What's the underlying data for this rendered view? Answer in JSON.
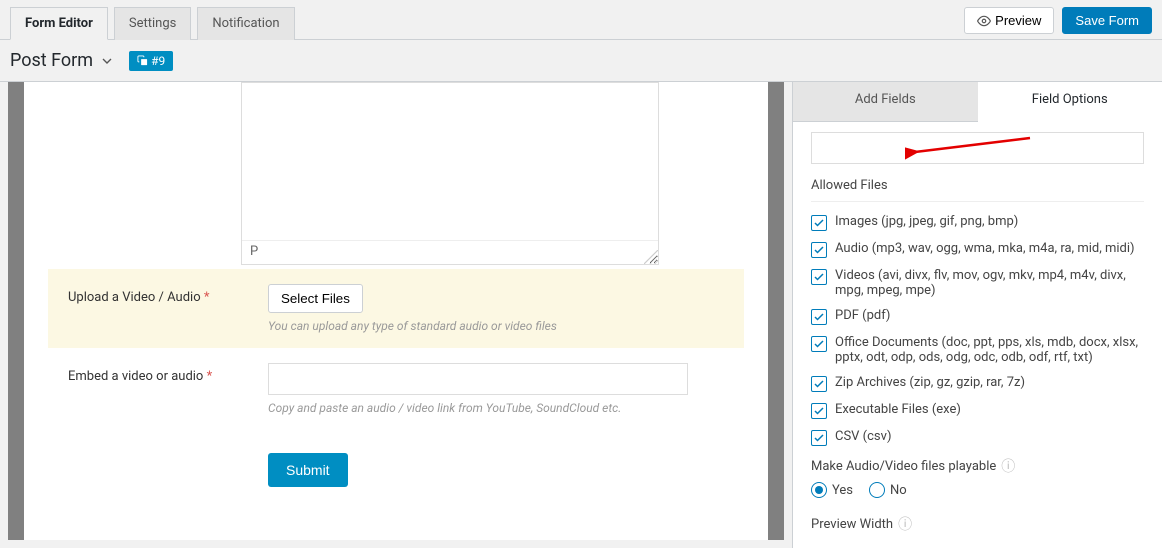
{
  "tabs": {
    "form_editor": "Form Editor",
    "settings": "Settings",
    "notification": "Notification"
  },
  "actions": {
    "preview": "Preview",
    "save": "Save Form"
  },
  "form": {
    "name": "Post Form",
    "count": "#9"
  },
  "editor": {
    "status": "P"
  },
  "upload_field": {
    "label": "Upload a Video / Audio",
    "button": "Select Files",
    "help": "You can upload any type of standard audio or video files"
  },
  "embed_field": {
    "label": "Embed a video or audio",
    "help": "Copy and paste an audio / video link from YouTube, SoundCloud etc."
  },
  "submit": "Submit",
  "panel_tabs": {
    "add": "Add Fields",
    "options": "Field Options"
  },
  "options": {
    "section": "Allowed Files",
    "types": [
      "Images (jpg, jpeg, gif, png, bmp)",
      "Audio (mp3, wav, ogg, wma, mka, m4a, ra, mid, midi)",
      "Videos (avi, divx, flv, mov, ogv, mkv, mp4, m4v, divx, mpg, mpeg, mpe)",
      "PDF (pdf)",
      "Office Documents (doc, ppt, pps, xls, mdb, docx, xlsx, pptx, odt, odp, ods, odg, odc, odb, odf, rtf, txt)",
      "Zip Archives (zip, gz, gzip, rar, 7z)",
      "Executable Files (exe)",
      "CSV (csv)"
    ],
    "playable": "Make Audio/Video files playable",
    "yes": "Yes",
    "no": "No",
    "preview_width": "Preview Width"
  }
}
